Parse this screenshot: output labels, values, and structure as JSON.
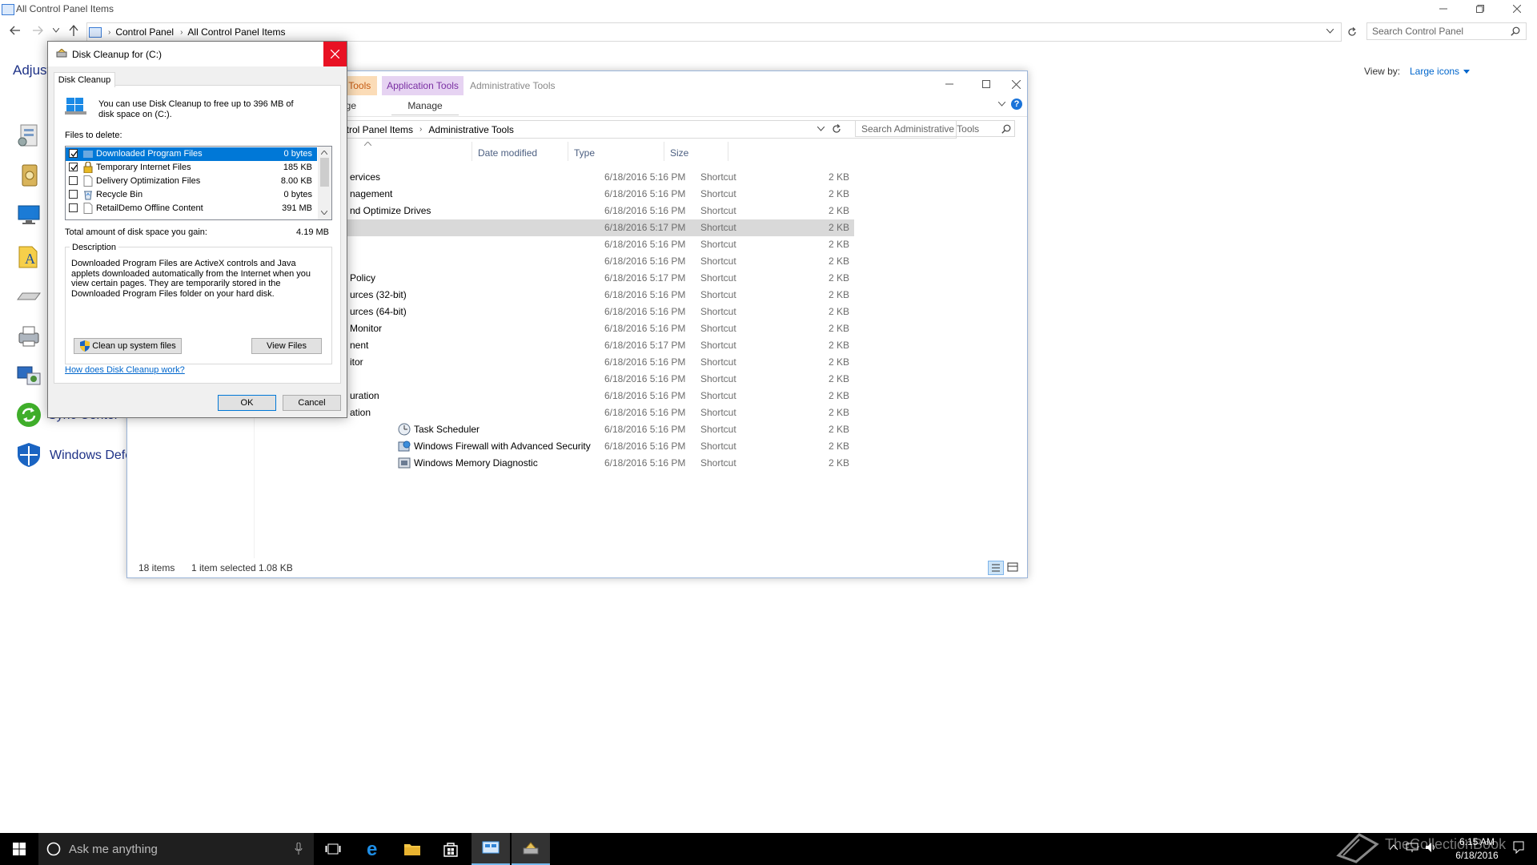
{
  "control_panel": {
    "window_title": "All Control Panel Items",
    "breadcrumb": [
      "Control Panel",
      "All Control Panel Items"
    ],
    "search_placeholder": "Search Control Panel",
    "heading": "Adjust",
    "view_by_label": "View by:",
    "view_by_value": "Large icons",
    "items": [
      {
        "label": "Sync Center",
        "icon": "sync-center-icon"
      },
      {
        "label": "Windows Defe",
        "icon": "windows-defender-icon"
      }
    ]
  },
  "admin_tools": {
    "title": "Administrative Tools",
    "ribbon_tabs": [
      "t Tools",
      "Application Tools"
    ],
    "ribbon_commands": [
      "age",
      "Manage"
    ],
    "breadcrumb": [
      "ntrol Panel Items",
      "Administrative Tools"
    ],
    "search_placeholder": "Search Administrative Tools",
    "columns": [
      "Date modified",
      "Type",
      "Size"
    ],
    "rows": [
      {
        "name": "ervices",
        "date": "6/18/2016 5:16 PM",
        "type": "Shortcut",
        "size": "2 KB"
      },
      {
        "name": "nagement",
        "date": "6/18/2016 5:16 PM",
        "type": "Shortcut",
        "size": "2 KB"
      },
      {
        "name": "nd Optimize Drives",
        "date": "6/18/2016 5:16 PM",
        "type": "Shortcut",
        "size": "2 KB"
      },
      {
        "name": "",
        "date": "6/18/2016 5:17 PM",
        "type": "Shortcut",
        "size": "2 KB",
        "selected": true
      },
      {
        "name": "",
        "date": "6/18/2016 5:16 PM",
        "type": "Shortcut",
        "size": "2 KB"
      },
      {
        "name": "",
        "date": "6/18/2016 5:16 PM",
        "type": "Shortcut",
        "size": "2 KB"
      },
      {
        "name": "Policy",
        "date": "6/18/2016 5:17 PM",
        "type": "Shortcut",
        "size": "2 KB"
      },
      {
        "name": "urces (32-bit)",
        "date": "6/18/2016 5:16 PM",
        "type": "Shortcut",
        "size": "2 KB"
      },
      {
        "name": "urces (64-bit)",
        "date": "6/18/2016 5:16 PM",
        "type": "Shortcut",
        "size": "2 KB"
      },
      {
        "name": "Monitor",
        "date": "6/18/2016 5:16 PM",
        "type": "Shortcut",
        "size": "2 KB"
      },
      {
        "name": "nent",
        "date": "6/18/2016 5:17 PM",
        "type": "Shortcut",
        "size": "2 KB"
      },
      {
        "name": "itor",
        "date": "6/18/2016 5:16 PM",
        "type": "Shortcut",
        "size": "2 KB"
      },
      {
        "name": "",
        "date": "6/18/2016 5:16 PM",
        "type": "Shortcut",
        "size": "2 KB"
      },
      {
        "name": "uration",
        "date": "6/18/2016 5:16 PM",
        "type": "Shortcut",
        "size": "2 KB"
      },
      {
        "name": "ation",
        "date": "6/18/2016 5:16 PM",
        "type": "Shortcut",
        "size": "2 KB"
      },
      {
        "name": "Task Scheduler",
        "date": "6/18/2016 5:16 PM",
        "type": "Shortcut",
        "size": "2 KB",
        "icon": true
      },
      {
        "name": "Windows Firewall with Advanced Security",
        "date": "6/18/2016 5:16 PM",
        "type": "Shortcut",
        "size": "2 KB",
        "icon": true
      },
      {
        "name": "Windows Memory Diagnostic",
        "date": "6/18/2016 5:16 PM",
        "type": "Shortcut",
        "size": "2 KB",
        "icon": true
      }
    ],
    "status_count": "18 items",
    "status_selection": "1 item selected  1.08 KB"
  },
  "disk_cleanup": {
    "title": "Disk Cleanup for  (C:)",
    "tab": "Disk Cleanup",
    "intro": "You can use Disk Cleanup to free up to 396 MB of disk space on  (C:).",
    "files_label": "Files to delete:",
    "files": [
      {
        "name": "Downloaded Program Files",
        "size": "0 bytes",
        "checked": true,
        "selected": true
      },
      {
        "name": "Temporary Internet Files",
        "size": "185 KB",
        "checked": true
      },
      {
        "name": "Delivery Optimization Files",
        "size": "8.00 KB",
        "checked": false
      },
      {
        "name": "Recycle Bin",
        "size": "0 bytes",
        "checked": false
      },
      {
        "name": "RetailDemo Offline Content",
        "size": "391 MB",
        "checked": false
      }
    ],
    "total_label": "Total amount of disk space you gain:",
    "total_value": "4.19 MB",
    "description_label": "Description",
    "description_text": "Downloaded Program Files are ActiveX controls and Java applets downloaded automatically from the Internet when you view certain pages. They are temporarily stored in the Downloaded Program Files folder on your hard disk.",
    "cleanup_system_button": "Clean up system files",
    "view_files_button": "View Files",
    "help_link": "How does Disk Cleanup work?",
    "ok_button": "OK",
    "cancel_button": "Cancel"
  },
  "taskbar": {
    "search_placeholder": "Ask me anything",
    "time": "6:15 AM",
    "date": "6/18/2016",
    "watermark": "TheCollectionBook"
  },
  "colors": {
    "selection_blue": "#0078d7",
    "close_red": "#e81123",
    "link_blue": "#0066cc",
    "ribbon_orange": "#fbdcb7",
    "ribbon_purple": "#e6d3f2"
  }
}
